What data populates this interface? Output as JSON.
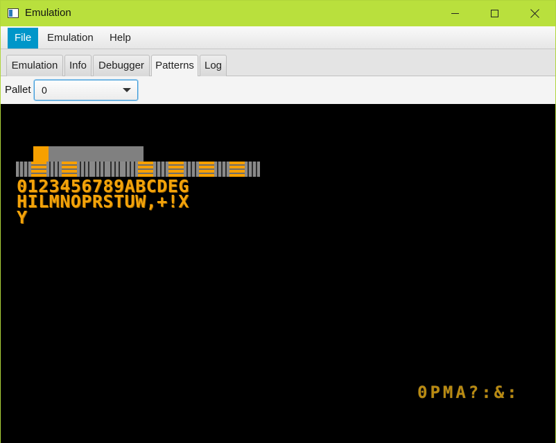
{
  "window": {
    "title": "Emulation",
    "icon": "java-app-icon",
    "titlebar_color": "#b9e03d"
  },
  "menubar": {
    "items": [
      {
        "label": "File",
        "selected": true
      },
      {
        "label": "Emulation",
        "selected": false
      },
      {
        "label": "Help",
        "selected": false
      }
    ],
    "selected_color": "#0096c9"
  },
  "tabs": [
    {
      "label": "Emulation",
      "active": false
    },
    {
      "label": "Info",
      "active": false
    },
    {
      "label": "Debugger",
      "active": false
    },
    {
      "label": "Patterns",
      "active": true
    },
    {
      "label": "Log",
      "active": false
    }
  ],
  "toolbar": {
    "pallet_label": "Pallet",
    "pallet_value": "0"
  },
  "pattern_view": {
    "background": "#000000",
    "glyph_color": "#f7a000",
    "rows": [
      "0123456789ABCDEG",
      "HILMNOPRSTUW,+!X",
      "Y"
    ],
    "sprite_strip": "0PMA?:&:"
  }
}
